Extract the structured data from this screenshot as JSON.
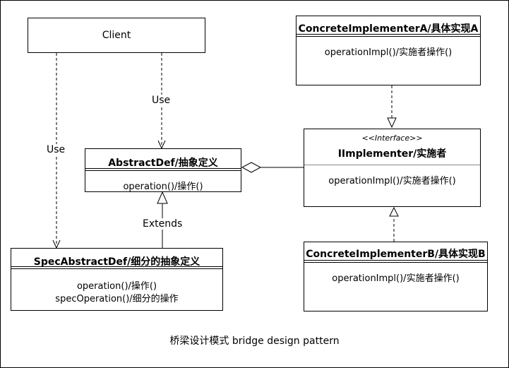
{
  "client": {
    "name": "Client"
  },
  "abstraction": {
    "name": "AbstractDef/抽象定义",
    "method": "operation()/操作()"
  },
  "refined": {
    "name": "SpecAbstractDef/细分的抽象定义",
    "method1": "operation()/操作()",
    "method2": "specOperation()/细分的操作"
  },
  "interface": {
    "stereotype": "<<Interface>>",
    "name": "IImplementer/实施者",
    "method": "operationImpl()/实施者操作()"
  },
  "concrete_a": {
    "name": "ConcreteImplementerA/具体实现A",
    "method": "operationImpl()/实施者操作()"
  },
  "concrete_b": {
    "name": "ConcreteImplementerB/具体实现B",
    "method": "operationImpl()/实施者操作()"
  },
  "edges": {
    "use1": "Use",
    "use2": "Use",
    "extends": "Extends"
  },
  "caption": "桥梁设计模式 bridge design pattern"
}
